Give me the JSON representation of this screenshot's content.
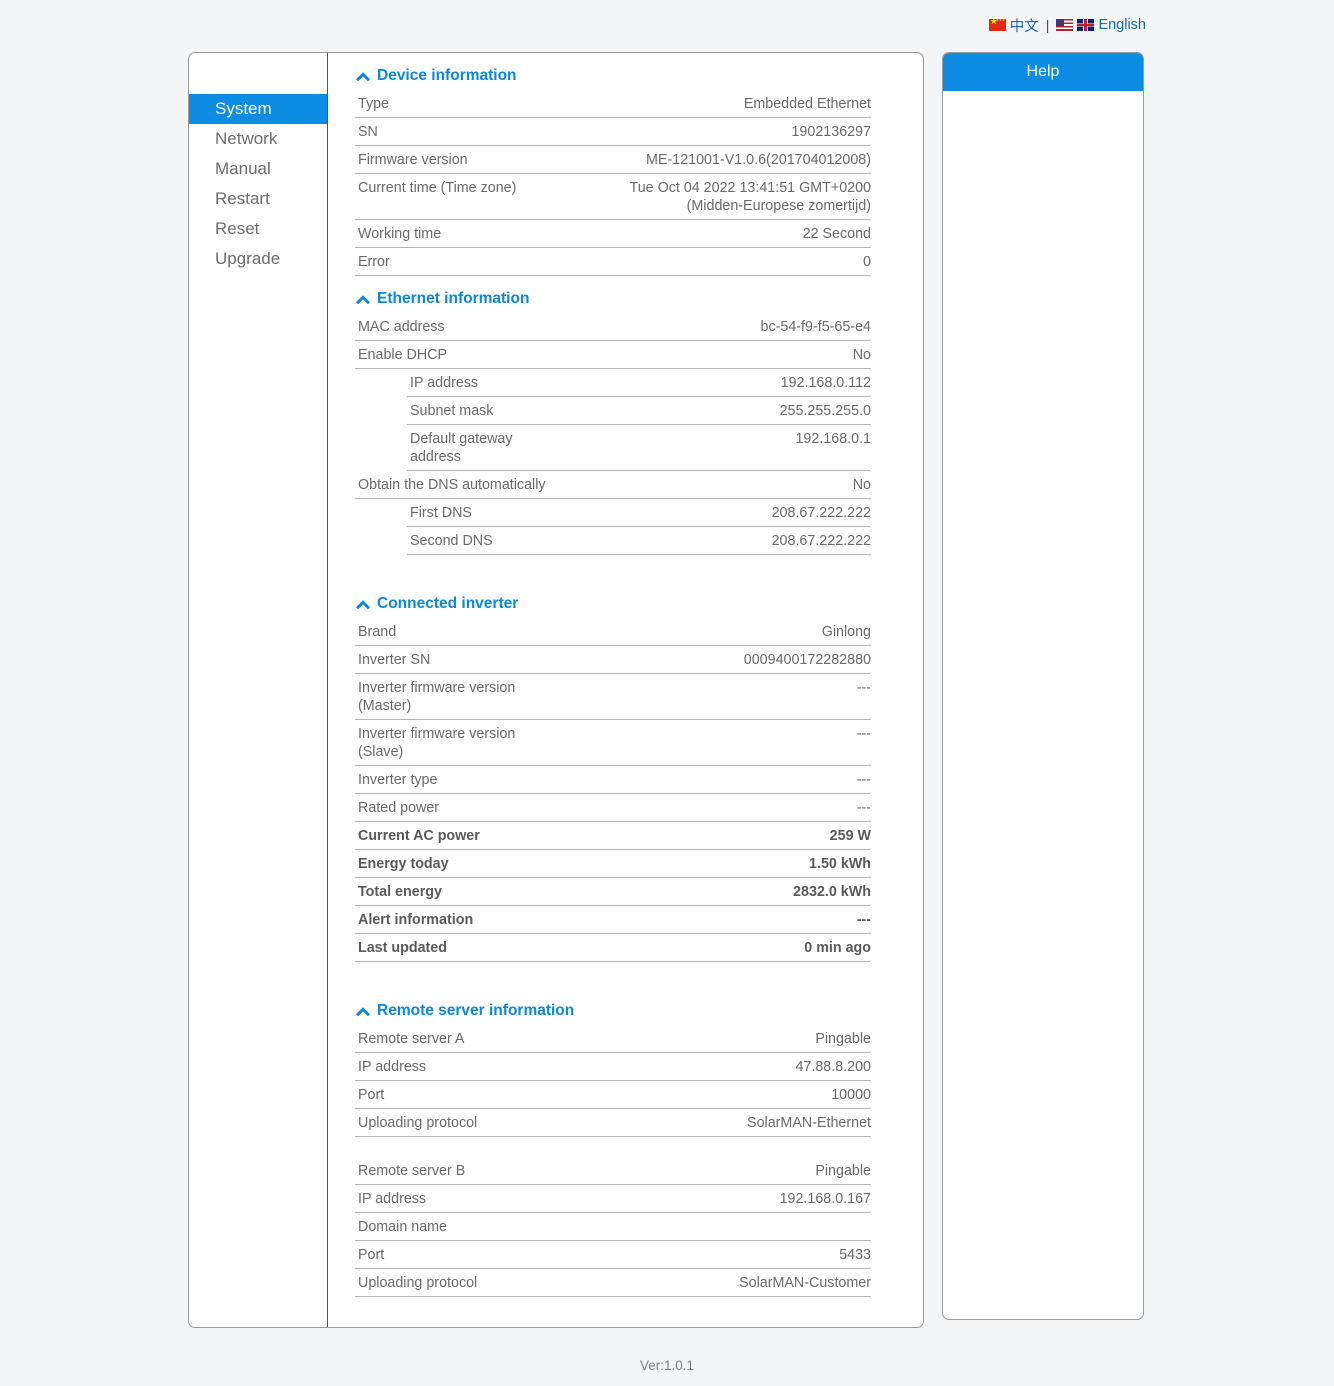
{
  "language_bar": {
    "chinese_label": "中文",
    "separator": "|",
    "english_label": "English",
    "link_color": "#1268c3"
  },
  "sidebar": {
    "items": [
      {
        "label": "System",
        "active": true
      },
      {
        "label": "Network",
        "active": false
      },
      {
        "label": "Manual",
        "active": false
      },
      {
        "label": "Restart",
        "active": false
      },
      {
        "label": "Reset",
        "active": false
      },
      {
        "label": "Upgrade",
        "active": false
      }
    ],
    "active_bg": "#0d8ce4"
  },
  "help": {
    "title": "Help",
    "body": "",
    "header_bg": "#0d8ce4"
  },
  "sections": {
    "device": {
      "title": "Device information",
      "rows": [
        {
          "label": "Type",
          "value": "Embedded Ethernet"
        },
        {
          "label": "SN",
          "value": "1902136297"
        },
        {
          "label": "Firmware version",
          "value": "ME-121001-V1.0.6(201704012008)"
        },
        {
          "label": "Current time  (Time zone)",
          "value": "Tue Oct 04 2022 13:41:51 GMT+0200\n(Midden-Europese zomertijd)"
        },
        {
          "label": "Working time",
          "value": "22 Second"
        },
        {
          "label": "Error",
          "value": "0"
        }
      ]
    },
    "ethernet": {
      "title": "Ethernet information",
      "rows": [
        {
          "label": "MAC address",
          "value": "bc-54-f9-f5-65-e4"
        },
        {
          "label": "Enable DHCP",
          "value": "No"
        },
        {
          "label": "IP address",
          "value": "192.168.0.112",
          "indent": true
        },
        {
          "label": "Subnet mask",
          "value": "255.255.255.0",
          "indent": true
        },
        {
          "label": "Default gateway\naddress",
          "value": "192.168.0.1",
          "indent": true
        },
        {
          "label": "Obtain the DNS automatically",
          "value": "No"
        },
        {
          "label": "First DNS",
          "value": "208.67.222.222",
          "indent": true
        },
        {
          "label": "Second DNS",
          "value": "208.67.222.222",
          "indent": true
        }
      ]
    },
    "inverter": {
      "title": "Connected inverter",
      "rows": [
        {
          "label": "Brand",
          "value": "Ginlong"
        },
        {
          "label": "Inverter SN",
          "value": "0009400172282880"
        },
        {
          "label": "Inverter firmware version\n  (Master)",
          "value": "---"
        },
        {
          "label": "Inverter firmware version\n  (Slave)",
          "value": "---"
        },
        {
          "label": "Inverter type",
          "value": "---"
        },
        {
          "label": "Rated power",
          "value": "---"
        },
        {
          "label": "Current AC power",
          "value": "259 W",
          "bold": true
        },
        {
          "label": "Energy today",
          "value": "1.50 kWh",
          "bold": true
        },
        {
          "label": "Total energy",
          "value": "2832.0 kWh",
          "bold": true
        },
        {
          "label": "Alert information",
          "value": "---",
          "bold": true
        },
        {
          "label": "Last updated",
          "value": "0 min ago",
          "bold": true
        }
      ]
    },
    "remote": {
      "title": "Remote server information",
      "rows": [
        {
          "label": "Remote server A",
          "value": "Pingable"
        },
        {
          "label": "IP address",
          "value": "47.88.8.200"
        },
        {
          "label": "Port",
          "value": "10000"
        },
        {
          "label": "Uploading protocol",
          "value": "SolarMAN-Ethernet"
        },
        {
          "gap": true
        },
        {
          "label": "Remote server B",
          "value": "Pingable"
        },
        {
          "label": "IP address",
          "value": "192.168.0.167"
        },
        {
          "label": "Domain name",
          "value": ""
        },
        {
          "label": "Port",
          "value": "5433"
        },
        {
          "label": "Uploading protocol",
          "value": "SolarMAN-Customer"
        }
      ]
    }
  },
  "footer": {
    "version": "Ver:1.0.1"
  }
}
